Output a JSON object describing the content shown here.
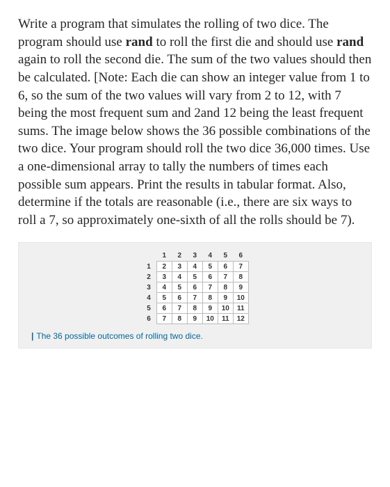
{
  "problem": {
    "p1a": "Write a program that simulates the rolling of two dice. The program should use ",
    "rand1": "rand",
    "p1b": " to roll the first die and should use ",
    "rand2": "rand",
    "p1c": " again to roll the second die. The sum of the two values should then be calculated. [Note: Each die can show an integer value from 1 to 6, so the sum of the two values will vary from 2 to 12, with 7 being the most frequent sum and 2and 12 being the least frequent sums. The image below shows the 36 possible combinations of the two dice. Your program should roll the two dice 36,000 times. Use a one-dimensional array to tally the numbers of times each possible sum appears. Print the results in tabular format. Also, determine if the totals are reasonable (i.e., there are six ways to roll a 7, so approximately one-sixth of all the rolls should be 7)."
  },
  "chart_data": {
    "type": "table",
    "title": "The 36 possible outcomes of rolling two dice.",
    "col_headers": [
      "1",
      "2",
      "3",
      "4",
      "5",
      "6"
    ],
    "row_headers": [
      "1",
      "2",
      "3",
      "4",
      "5",
      "6"
    ],
    "rows": [
      [
        "2",
        "3",
        "4",
        "5",
        "6",
        "7"
      ],
      [
        "3",
        "4",
        "5",
        "6",
        "7",
        "8"
      ],
      [
        "4",
        "5",
        "6",
        "7",
        "8",
        "9"
      ],
      [
        "5",
        "6",
        "7",
        "8",
        "9",
        "10"
      ],
      [
        "6",
        "7",
        "8",
        "9",
        "10",
        "11"
      ],
      [
        "7",
        "8",
        "9",
        "10",
        "11",
        "12"
      ]
    ]
  },
  "caption_bar": "|",
  "caption_text": "The 36 possible outcomes of rolling two dice."
}
